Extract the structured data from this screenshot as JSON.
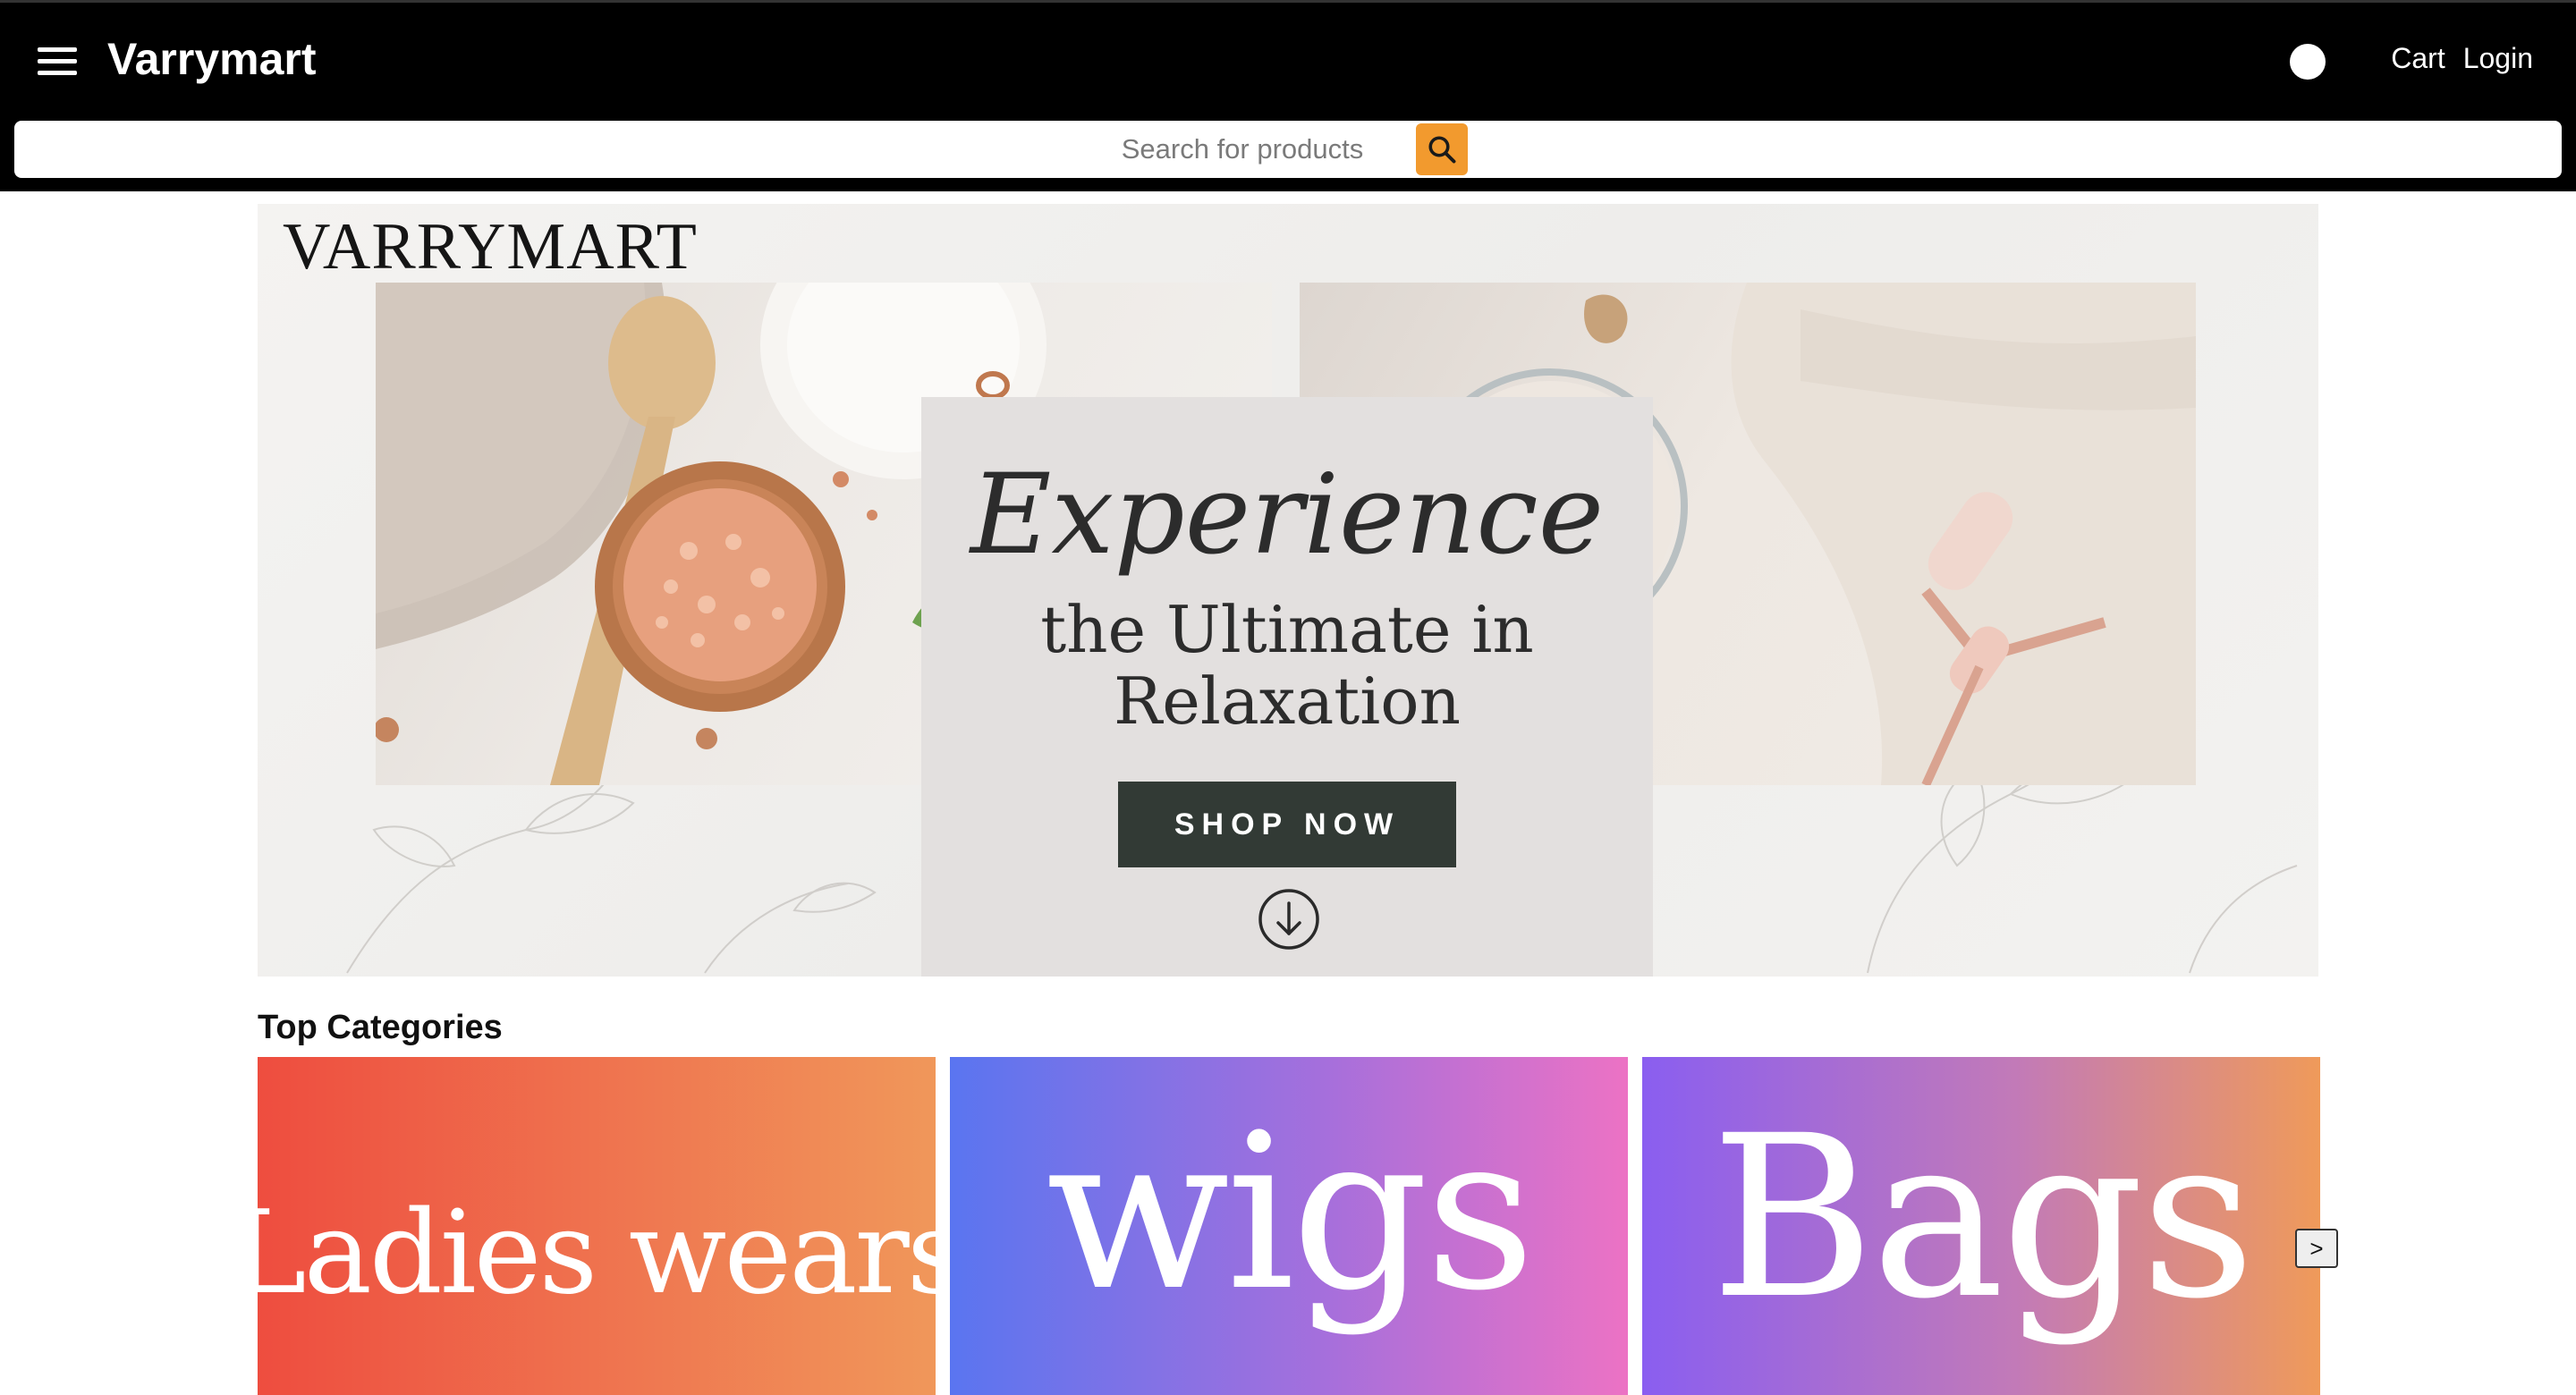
{
  "header": {
    "brand": "Varrymart",
    "nav": {
      "cart": "Cart",
      "login": "Login"
    }
  },
  "search": {
    "placeholder": "Search for products"
  },
  "hero": {
    "logo": "VARRYMART",
    "headline": "Experience",
    "subheadline_line1": "the Ultimate in",
    "subheadline_line2": "Relaxation",
    "cta": "SHOP NOW"
  },
  "categories": {
    "title": "Top Categories",
    "items": [
      {
        "label": "Ladies wears"
      },
      {
        "label": "wigs"
      },
      {
        "label": "Bags"
      }
    ],
    "next_label": ">"
  },
  "colors": {
    "header_bg": "#000000",
    "search_button": "#f29a2e",
    "cta_bg": "#323a35"
  },
  "icons": [
    "menu-icon",
    "search-icon",
    "arrow-down-circle-icon",
    "theme-toggle-icon"
  ]
}
